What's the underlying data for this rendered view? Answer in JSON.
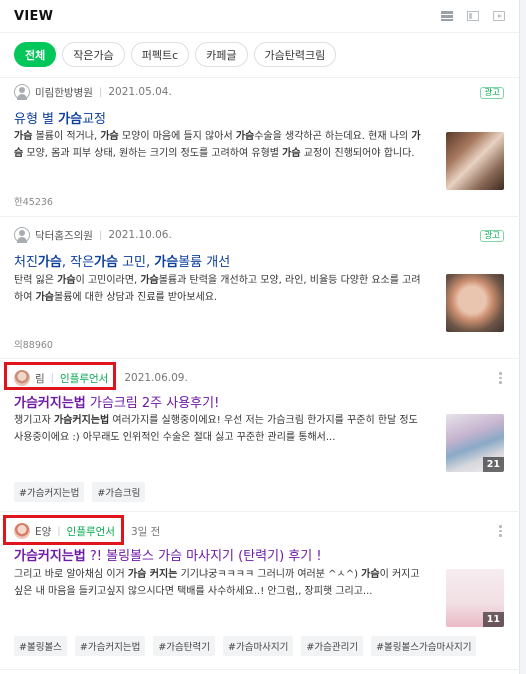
{
  "header": {
    "title": "VIEW",
    "view_icons": [
      "list-view-icon",
      "thumbnail-view-icon",
      "video-view-icon"
    ]
  },
  "tabs": [
    "전체",
    "작은가슴",
    "퍼펙트c",
    "카페글",
    "가슴탄력크림"
  ],
  "cards": [
    {
      "author": "미림한방병원",
      "date": "2021.05.04.",
      "ad": "광고",
      "title_pre": "유형 별 ",
      "title_hl": "가슴",
      "title_post": "교정",
      "desc_html": "<b>가슴</b> 볼륨이 적거나, <b>가슴</b> 모양이 마음에 들지 않아서 <b>가슴</b>수술을 생각하곤 하는데요. 현재 나의 <b>가슴</b> 모양, 몸과 피부 상태, 원하는 크기의 정도를 고려하여 유형별 <b>가슴</b> 교정이 진행되어야 합니다.",
      "stat": "한45236"
    },
    {
      "author": "닥터홈즈의원",
      "date": "2021.10.06.",
      "ad": "광고",
      "title_html": "처진<b>가슴</b>, 작은<b>가슴</b> 고민, <b>가슴</b>볼륨 개선",
      "desc_html": "탄력 잃은 <b>가슴</b>이 고민이라면, <b>가슴</b>볼륨과 탄력을 개선하고 모양, 라인, 비율등 다양한 요소를 고려하여 <b>가슴</b>볼륨에 대한 상담과 진료를 받아보세요.",
      "stat": "의88960"
    },
    {
      "author": "림",
      "badge": "인플루언서",
      "date": "2021.06.09.",
      "title_html": "<b>가슴커지는법</b> 가슴크림 2주 사용후기!",
      "desc_html": "챙기고자 <b>가슴커지는법</b> 여러가지를 실행중이에요! 우선 저는 가슴크림 한가지를 꾸준히 한달 정도 사용중이에요 :) 아무래도 인위적인 수술은 절대 싫고 꾸준한 관리를 통해서...",
      "image_count": "21",
      "tags": [
        "#가슴커지는법",
        "#가슴크림"
      ]
    },
    {
      "author": "E양",
      "badge": "인플루언서",
      "date": "3일 전",
      "title_html": "<b>가슴커지는법</b> ?! 볼링볼스 가슴 마사지기 (탄력기) 후기 !",
      "desc_html": "그리고 바로 알아채심 이거 <b>가슴 커지는</b> 기기냐궁ㅋㅋㅋㅋ 그러니까 여러분 ^ㅅ^) <b>가슴</b>이 커지고싶은 내 마음을 들키고싶지 않으시다면 택배를 사수하세요..! 안그럼,, 장피햇 그리고...",
      "image_count": "11",
      "tags": [
        "#볼링볼스",
        "#가슴커지는법",
        "#가슴탄력기",
        "#가슴마사지기",
        "#가슴관리기",
        "#볼링볼스가슴마사지기"
      ]
    }
  ],
  "colors": {
    "accent": "#03c75a",
    "title_blue": "#0c3f9b",
    "title_purple": "#6d1aa7",
    "highlight_box": "#e0141c"
  }
}
